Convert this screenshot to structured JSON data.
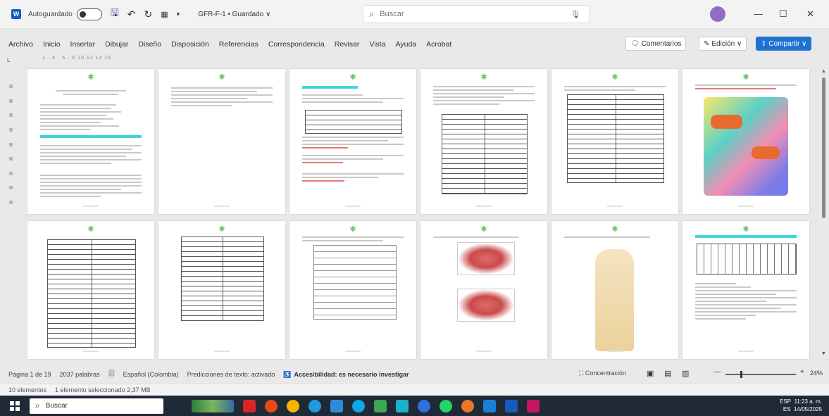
{
  "titlebar": {
    "autosave_label": "Autoguardado",
    "filename": "GFR-F-1 • Guardado ∨",
    "search_placeholder": "Buscar",
    "minimize": "—",
    "maximize": "☐",
    "close": "✕"
  },
  "menu": [
    "Archivo",
    "Inicio",
    "Insertar",
    "Dibujar",
    "Diseño",
    "Disposición",
    "Referencias",
    "Correspondencia",
    "Revisar",
    "Vista",
    "Ayuda",
    "Acrobat"
  ],
  "ribbon_right": {
    "comments": "Comentarios",
    "editing": "Edición ∨",
    "share": "Compartir ∨"
  },
  "ruler": "2 · 4 · 6 · 8 10 12 14 16",
  "status": {
    "page": "Página 1 de 19",
    "words": "2037 palabras",
    "language": "Español (Colombia)",
    "predictions": "Predicciones de texto: activado",
    "accessibility": "Accesibilidad: es necesario investigar",
    "concentration": "Concentración",
    "zoom": "24%"
  },
  "explorer": {
    "items": "10 elementos",
    "selected": "1 elemento seleccionado 2,37 MB"
  },
  "taskbar": {
    "search": "Buscar",
    "lang": "ESP",
    "lang2": "ES",
    "time": "11:23 a. m.",
    "date": "14/05/2025"
  },
  "colors": {
    "word_blue": "#185abd",
    "share_blue": "#1e73d2",
    "highlight_cyan": "#3fd3e0",
    "taskbar": "#1f2a36"
  }
}
